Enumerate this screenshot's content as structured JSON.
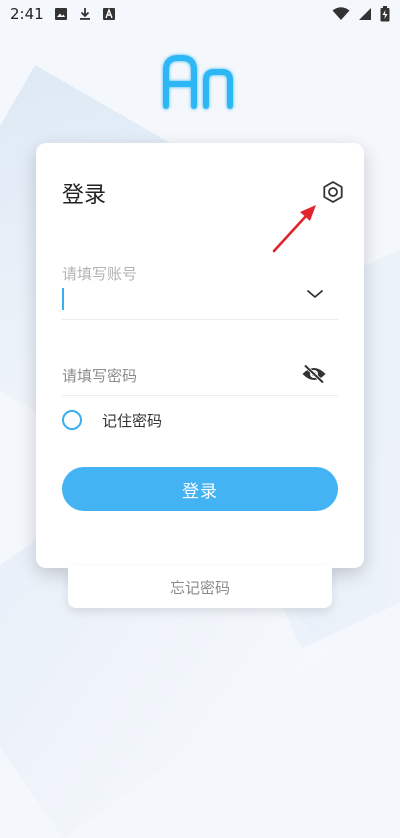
{
  "status_bar": {
    "time": "2:41",
    "icons": [
      "image-icon",
      "download-icon",
      "font-icon",
      "wifi-icon",
      "signal-icon",
      "battery-icon"
    ]
  },
  "logo": {
    "text": "An",
    "color": "#2fb7f5"
  },
  "login": {
    "title": "登录",
    "account_label": "请填写账号",
    "account_value": "",
    "password_placeholder": "请填写密码",
    "remember_label": "记住密码",
    "remember_checked": false,
    "submit_label": "登录"
  },
  "forgot": {
    "label": "忘记密码"
  },
  "colors": {
    "accent": "#43b3f4",
    "annotation": "#e0242b"
  }
}
